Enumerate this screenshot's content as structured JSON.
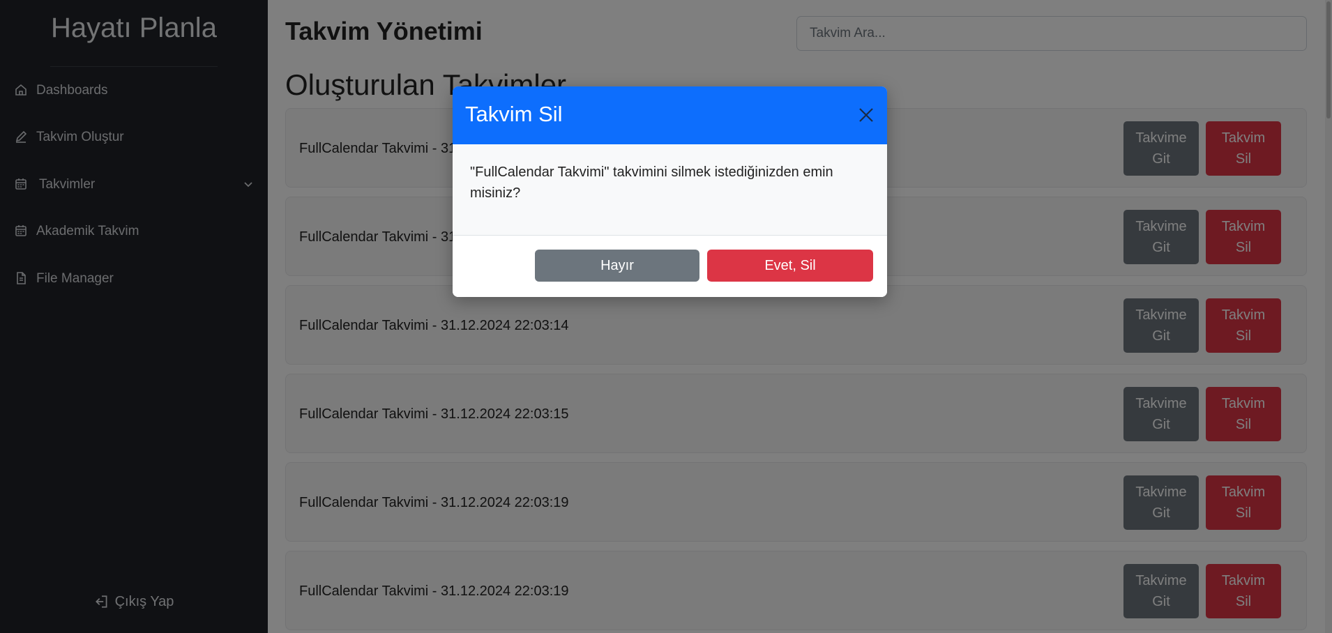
{
  "sidebar": {
    "brand": "Hayatı Planla",
    "items": [
      {
        "label": "Dashboards"
      },
      {
        "label": "Takvim Oluştur"
      },
      {
        "label": "Takvimler"
      },
      {
        "label": "Akademik Takvim"
      },
      {
        "label": "File Manager"
      }
    ],
    "logout": "Çıkış Yap"
  },
  "header": {
    "title": "Takvim Yönetimi",
    "search_placeholder": "Takvim Ara..."
  },
  "section": {
    "title": "Oluşturulan Takvimler"
  },
  "calendars": [
    {
      "name": "FullCalendar Takvimi - 31.12.2024 22:03:14"
    },
    {
      "name": "FullCalendar Takvimi - 31.12.2024 22:03:14"
    },
    {
      "name": "FullCalendar Takvimi - 31.12.2024 22:03:14"
    },
    {
      "name": "FullCalendar Takvimi - 31.12.2024 22:03:15"
    },
    {
      "name": "FullCalendar Takvimi - 31.12.2024 22:03:19"
    },
    {
      "name": "FullCalendar Takvimi - 31.12.2024 22:03:19"
    }
  ],
  "card_buttons": {
    "go_line1": "Takvime",
    "go_line2": "Git",
    "delete_line1": "Takvim",
    "delete_line2": "Sil"
  },
  "modal": {
    "title": "Takvim Sil",
    "message": "\"FullCalendar Takvimi\" takvimini silmek istediğinizden emin misiniz?",
    "no_label": "Hayır",
    "yes_label": "Evet, Sil"
  },
  "colors": {
    "primary": "#0d6efd",
    "danger": "#dc3545",
    "secondary": "#6c757d",
    "sidebar": "#202329"
  }
}
